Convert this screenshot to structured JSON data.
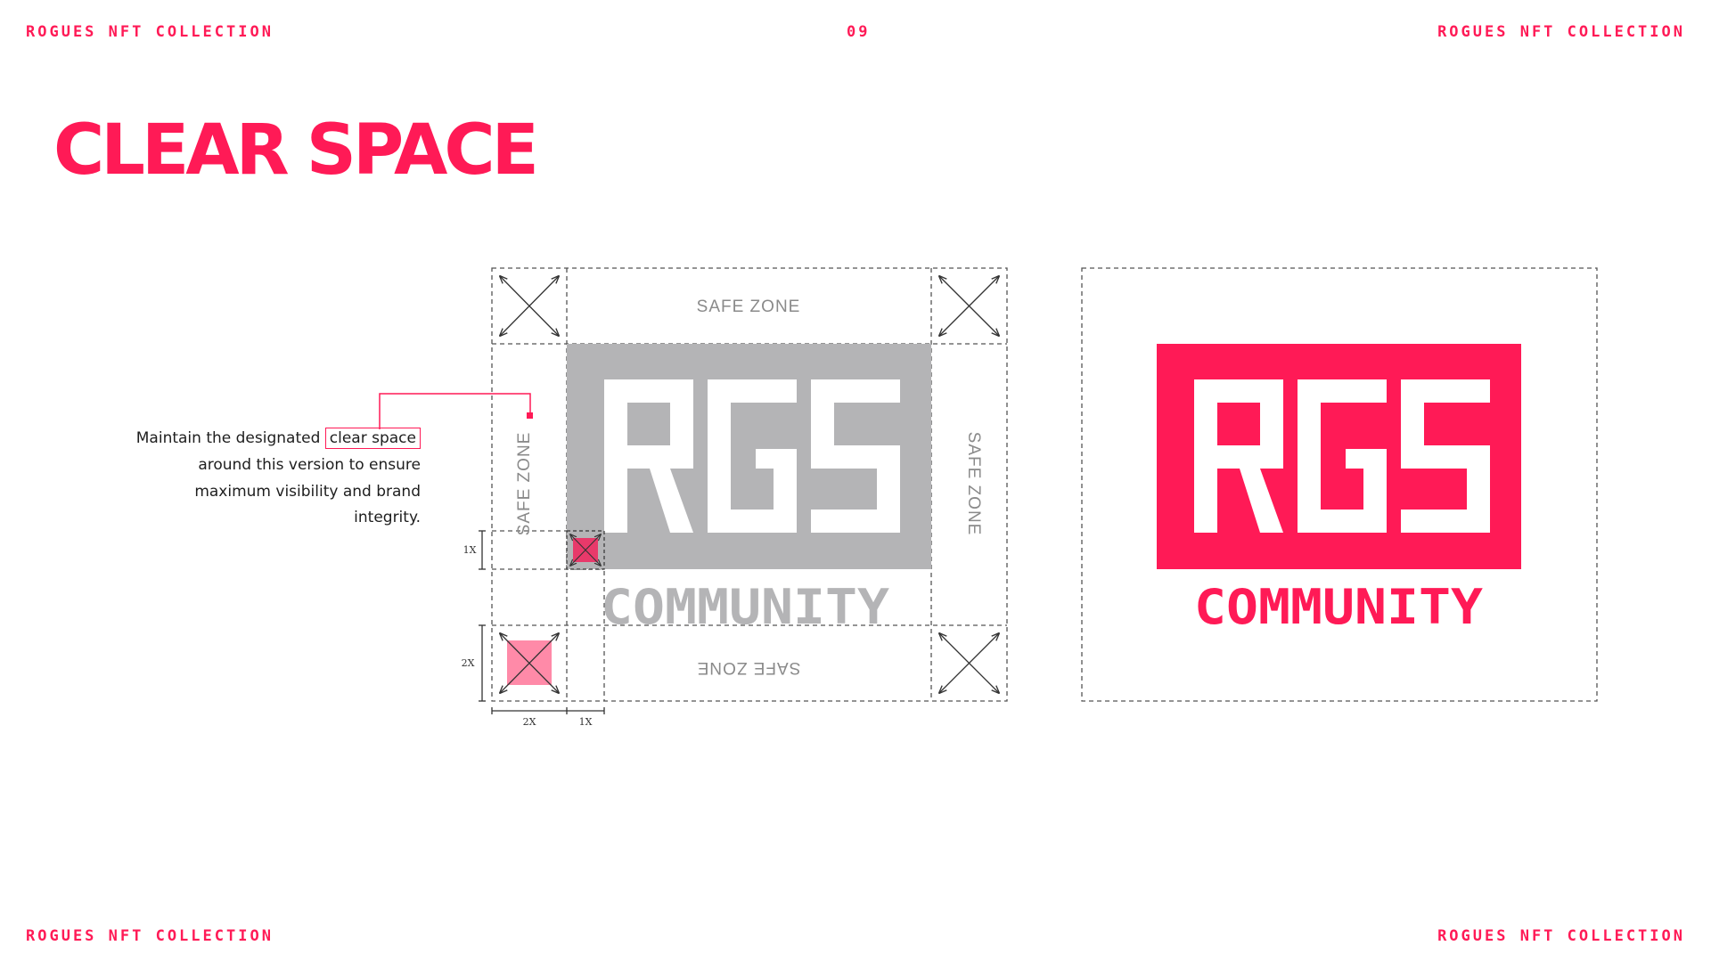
{
  "header": {
    "left": "ROGUES NFT COLLECTION",
    "page_number": "09",
    "right": "ROGUES NFT COLLECTION"
  },
  "footer": {
    "left": "ROGUES NFT COLLECTION",
    "right": "ROGUES NFT COLLECTION"
  },
  "title": "CLEAR SPACE",
  "description": {
    "line1_before": "Maintain the designated",
    "highlight": "clear space",
    "line2": "around this version to ensure",
    "line3": "maximum visibility and brand",
    "line4": "integrity."
  },
  "diagram": {
    "safe_zone": "SAFE ZONE",
    "logo_mark": "RGS",
    "logo_word": "COMMUNITY",
    "unit_1x": "1X",
    "unit_2x": "2X"
  },
  "colors": {
    "accent": "#ff1a56",
    "logo_gray": "#b4b4b6",
    "pink_light": "#ff8aa8",
    "guide": "#555555"
  }
}
